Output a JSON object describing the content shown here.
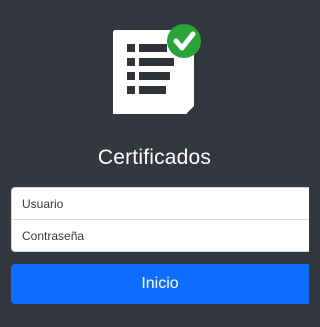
{
  "app": {
    "title": "Certificados",
    "logo_icon": "certificate-document-check-icon"
  },
  "login_form": {
    "username_placeholder": "Usuario",
    "username_value": "",
    "password_placeholder": "Contraseña",
    "password_value": "",
    "submit_label": "Inicio"
  },
  "colors": {
    "background": "#34383e",
    "accent_button": "#0d6efd",
    "check_badge": "#2aa33a"
  }
}
